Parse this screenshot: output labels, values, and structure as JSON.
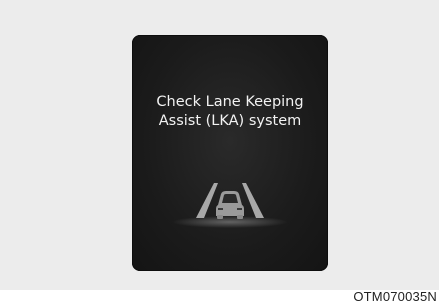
{
  "display": {
    "message_line1": "Check Lane Keeping",
    "message_line2": "Assist (LKA) system",
    "icon": "lane-keeping-assist-icon"
  },
  "caption": {
    "code": "OTM070035N"
  },
  "colors": {
    "background": "#ececec",
    "display": "#1b1b1b",
    "text": "#f2f2f2",
    "icon_gray": "#9a9a9a"
  }
}
